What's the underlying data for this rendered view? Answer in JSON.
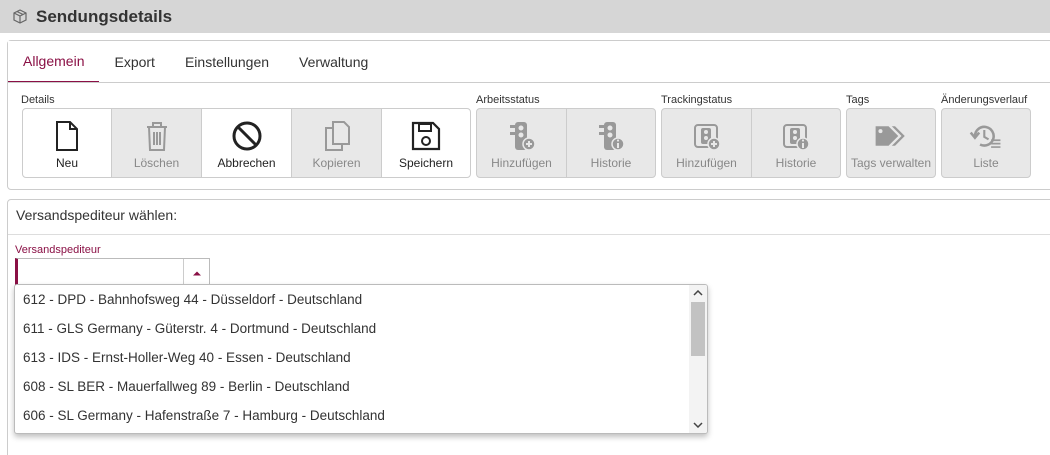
{
  "window": {
    "title": "Sendungsdetails",
    "icon": "package-icon"
  },
  "tabs": [
    {
      "label": "Allgemein",
      "active": true
    },
    {
      "label": "Export",
      "active": false
    },
    {
      "label": "Einstellungen",
      "active": false
    },
    {
      "label": "Verwaltung",
      "active": false
    }
  ],
  "groups": {
    "details": {
      "label": "Details"
    },
    "arbeitsstatus": {
      "label": "Arbeitsstatus"
    },
    "trackingstatus": {
      "label": "Trackingstatus"
    },
    "tags": {
      "label": "Tags"
    },
    "aenderungsverlauf": {
      "label": "Änderungsverlauf"
    }
  },
  "buttons": {
    "neu": {
      "label": "Neu",
      "icon": "new-document-icon",
      "enabled": true
    },
    "loeschen": {
      "label": "Löschen",
      "icon": "trash-icon",
      "enabled": false
    },
    "abbrechen": {
      "label": "Abbrechen",
      "icon": "cancel-icon",
      "enabled": true
    },
    "kopieren": {
      "label": "Kopieren",
      "icon": "copy-icon",
      "enabled": false
    },
    "speichern": {
      "label": "Speichern",
      "icon": "save-icon",
      "enabled": true
    },
    "arbeitsstatus_hinzufuegen": {
      "label": "Hinzufügen",
      "icon": "traffic-light-add-icon",
      "enabled": false
    },
    "arbeitsstatus_historie": {
      "label": "Historie",
      "icon": "traffic-light-info-icon",
      "enabled": false
    },
    "tracking_hinzufuegen": {
      "label": "Hinzufügen",
      "icon": "tracking-add-icon",
      "enabled": false
    },
    "tracking_historie": {
      "label": "Historie",
      "icon": "tracking-info-icon",
      "enabled": false
    },
    "tags_verwalten": {
      "label": "Tags verwalten",
      "icon": "tags-icon",
      "enabled": false
    },
    "liste": {
      "label": "Liste",
      "icon": "history-list-icon",
      "enabled": false
    }
  },
  "section": {
    "title": "Versandspediteur wählen:",
    "field_label": "Versandspediteur",
    "field_value": ""
  },
  "dropdown": {
    "options": [
      "612 - DPD - Bahnhofsweg 44 - Düsseldorf - Deutschland",
      "611 - GLS Germany - Güterstr. 4 - Dortmund - Deutschland",
      "613 - IDS - Ernst-Holler-Weg 40 - Essen - Deutschland",
      "608 - SL BER - Mauerfallweg 89 - Berlin - Deutschland",
      "606 - SL Germany - Hafenstraße 7 - Hamburg - Deutschland"
    ]
  },
  "colors": {
    "accent": "#8a1045",
    "disabled_bg": "#e8e8e8",
    "titlebar_bg": "#d6d6d6"
  }
}
